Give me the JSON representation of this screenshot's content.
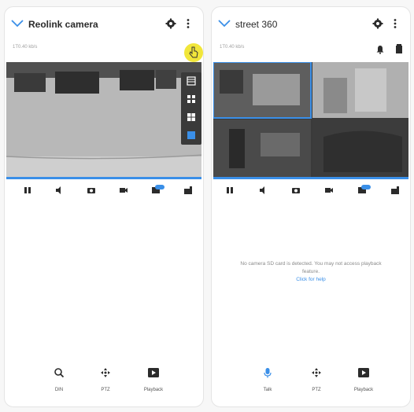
{
  "left_panel": {
    "title": "Reolink camera",
    "subtitle": "1T0.40 kb/s",
    "icons": {
      "header": [
        "chevron-down-icon",
        "gear-icon",
        "more-vert-icon"
      ],
      "toolbar": [
        "pause-icon",
        "volume-icon",
        "camera-icon",
        "record-icon",
        "clear-mode-icon",
        "layout-grid-icon"
      ],
      "layout_menu": [
        "layout-1x1-icon",
        "layout-2x2-icon",
        "layout-3x3-icon",
        "layout-custom-icon"
      ]
    },
    "bottom": [
      {
        "label": "DIN",
        "icon": "search-icon"
      },
      {
        "label": "PTZ",
        "icon": "move-icon"
      },
      {
        "label": "Playback",
        "icon": "playback-icon"
      }
    ]
  },
  "right_panel": {
    "title": "street 360",
    "subtitle": "1T0.40 kb/s",
    "icons": {
      "header": [
        "chevron-down-icon",
        "gear-icon",
        "more-vert-icon"
      ],
      "toolbar": [
        "pause-icon",
        "volume-icon",
        "camera-icon",
        "record-icon",
        "clear-mode-icon",
        "layout-grid-icon"
      ]
    },
    "message": "No camera SD card is detected. You may not access playback feature.",
    "message_link": "Click for help",
    "bottom": [
      {
        "label": "Talk",
        "icon": "mic-icon"
      },
      {
        "label": "PTZ",
        "icon": "move-icon"
      },
      {
        "label": "Playback",
        "icon": "playback-icon"
      }
    ]
  },
  "colors": {
    "accent": "#3a8fe8",
    "highlight": "#f1e63a",
    "dropdown_bg": "#3a3a3a"
  }
}
